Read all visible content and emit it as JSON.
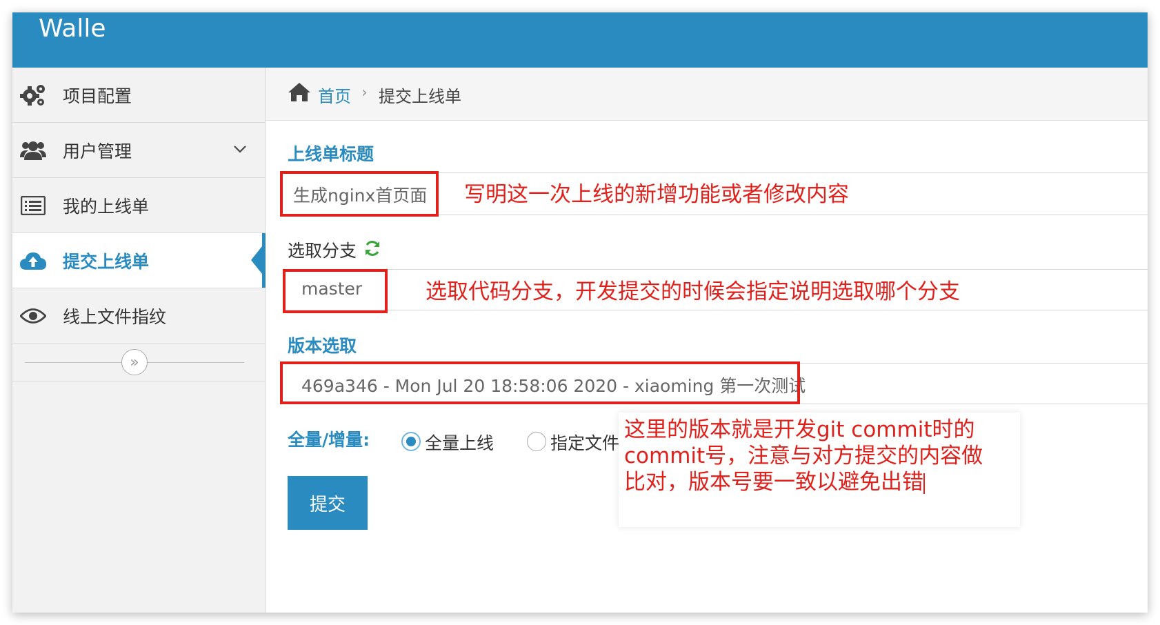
{
  "app": {
    "brand": "Walle"
  },
  "sidebar": {
    "items": [
      {
        "label": "项目配置",
        "icon": "gears-icon"
      },
      {
        "label": "用户管理",
        "icon": "users-icon",
        "has_submenu": true
      },
      {
        "label": "我的上线单",
        "icon": "list-icon"
      },
      {
        "label": "提交上线单",
        "icon": "cloud-upload-icon",
        "active": true
      },
      {
        "label": "线上文件指纹",
        "icon": "eye-icon"
      }
    ],
    "collapse_glyph": "»"
  },
  "breadcrumb": {
    "home": "首页",
    "current": "提交上线单"
  },
  "form": {
    "title_label": "上线单标题",
    "title_value": "生成nginx首页面",
    "branch_label": "选取分支",
    "branch_value": "master",
    "version_label": "版本选取",
    "version_value": "469a346 - Mon Jul 20 18:58:06 2020 - xiaoming 第一次测试",
    "mode_label": "全量/增量:",
    "mode_options": [
      "全量上线",
      "指定文件"
    ],
    "mode_selected": "全量上线",
    "submit_label": "提交"
  },
  "annotations": {
    "title_note": "写明这一次上线的新增功能或者修改内容",
    "branch_note": "选取代码分支，开发提交的时候会指定说明选取哪个分支",
    "version_note_lines": [
      "这里的版本就是开发git commit时的",
      "commit号，注意与对方提交的内容做",
      "比对，版本号要一致以避免出错"
    ]
  },
  "colors": {
    "brand": "#2a8bc0",
    "annotation": "#e0201b",
    "refresh": "#3aa53a"
  }
}
